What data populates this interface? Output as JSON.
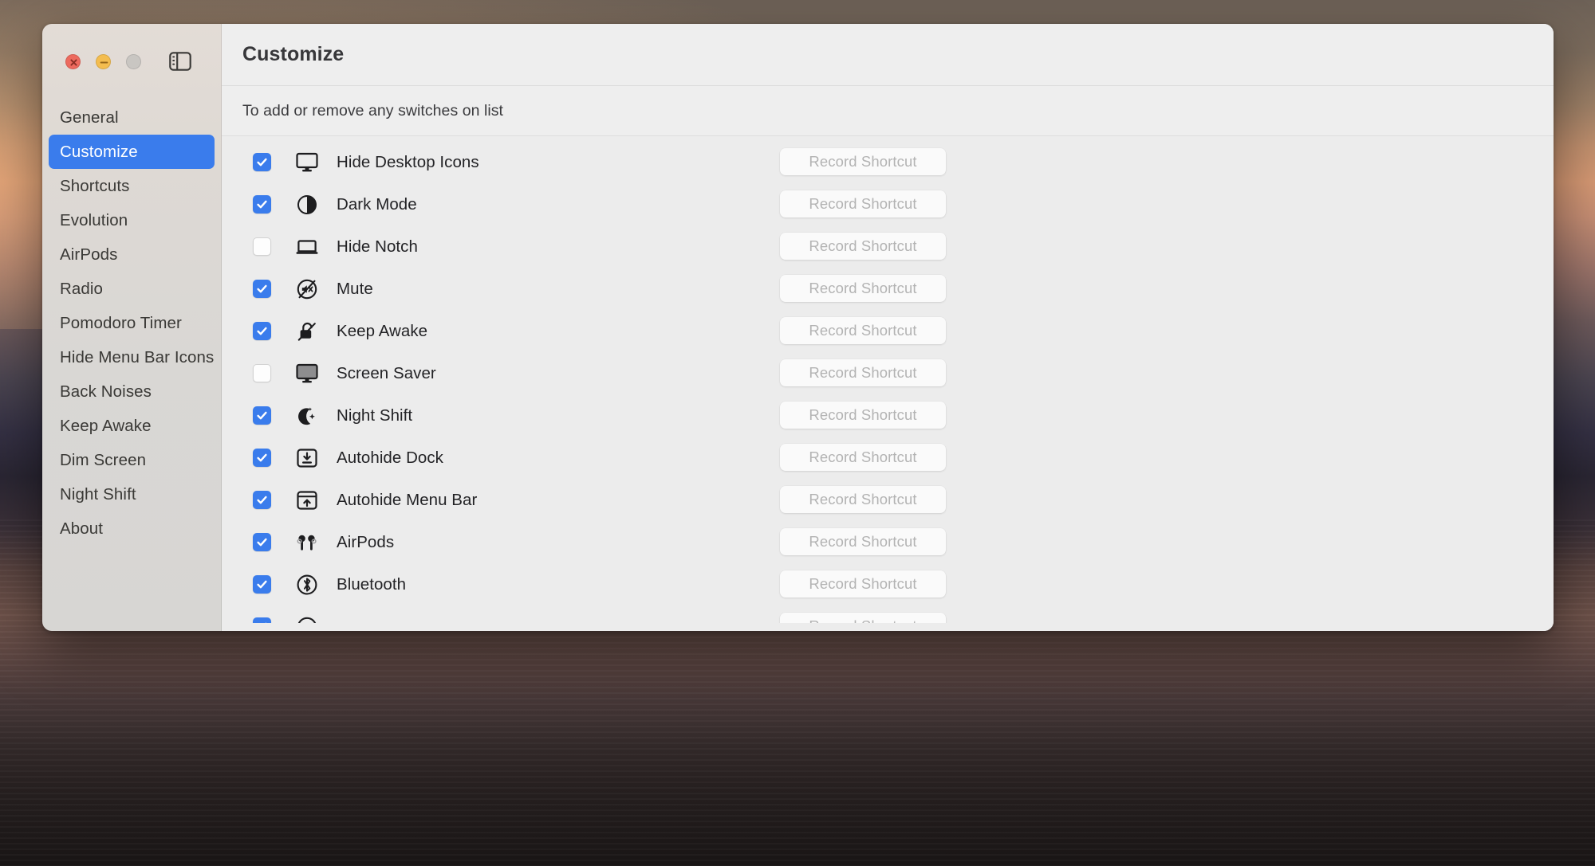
{
  "window": {
    "traffic_lights": [
      {
        "name": "close",
        "color": "#ed6a5e"
      },
      {
        "name": "minimize",
        "color": "#f4bd4f"
      },
      {
        "name": "maximize",
        "color": "#c9c6c2"
      }
    ],
    "sidebar_toggle_icon": "sidebar-toggle-icon"
  },
  "sidebar": {
    "items": [
      {
        "label": "General",
        "selected": false
      },
      {
        "label": "Customize",
        "selected": true
      },
      {
        "label": "Shortcuts",
        "selected": false
      },
      {
        "label": "Evolution",
        "selected": false
      },
      {
        "label": "AirPods",
        "selected": false
      },
      {
        "label": "Radio",
        "selected": false
      },
      {
        "label": "Pomodoro Timer",
        "selected": false
      },
      {
        "label": "Hide Menu Bar Icons",
        "selected": false
      },
      {
        "label": "Back Noises",
        "selected": false
      },
      {
        "label": "Keep Awake",
        "selected": false
      },
      {
        "label": "Dim Screen",
        "selected": false
      },
      {
        "label": "Night Shift",
        "selected": false
      },
      {
        "label": "About",
        "selected": false
      }
    ],
    "selected_color": "#3a7cec"
  },
  "header": {
    "title": "Customize",
    "subtitle": "To add or remove any switches on list"
  },
  "list": {
    "record_button_label": "Record Shortcut",
    "checkbox_on_color": "#3a7cec",
    "rows": [
      {
        "label": "Hide Desktop Icons",
        "checked": true,
        "icon": "display-icon"
      },
      {
        "label": "Dark Mode",
        "checked": true,
        "icon": "circle-half-filled-icon"
      },
      {
        "label": "Hide Notch",
        "checked": false,
        "icon": "laptop-icon"
      },
      {
        "label": "Mute",
        "checked": true,
        "icon": "speaker-slash-circle-icon"
      },
      {
        "label": "Keep Awake",
        "checked": true,
        "icon": "lock-open-slash-icon"
      },
      {
        "label": "Screen Saver",
        "checked": false,
        "icon": "display-filled-icon"
      },
      {
        "label": "Night Shift",
        "checked": true,
        "icon": "moon-stars-icon"
      },
      {
        "label": "Autohide Dock",
        "checked": true,
        "icon": "dock-arrow-down-icon"
      },
      {
        "label": "Autohide Menu Bar",
        "checked": true,
        "icon": "menubar-arrow-up-icon"
      },
      {
        "label": "AirPods",
        "checked": true,
        "icon": "airpods-icon"
      },
      {
        "label": "Bluetooth",
        "checked": true,
        "icon": "bluetooth-circle-icon"
      }
    ]
  }
}
